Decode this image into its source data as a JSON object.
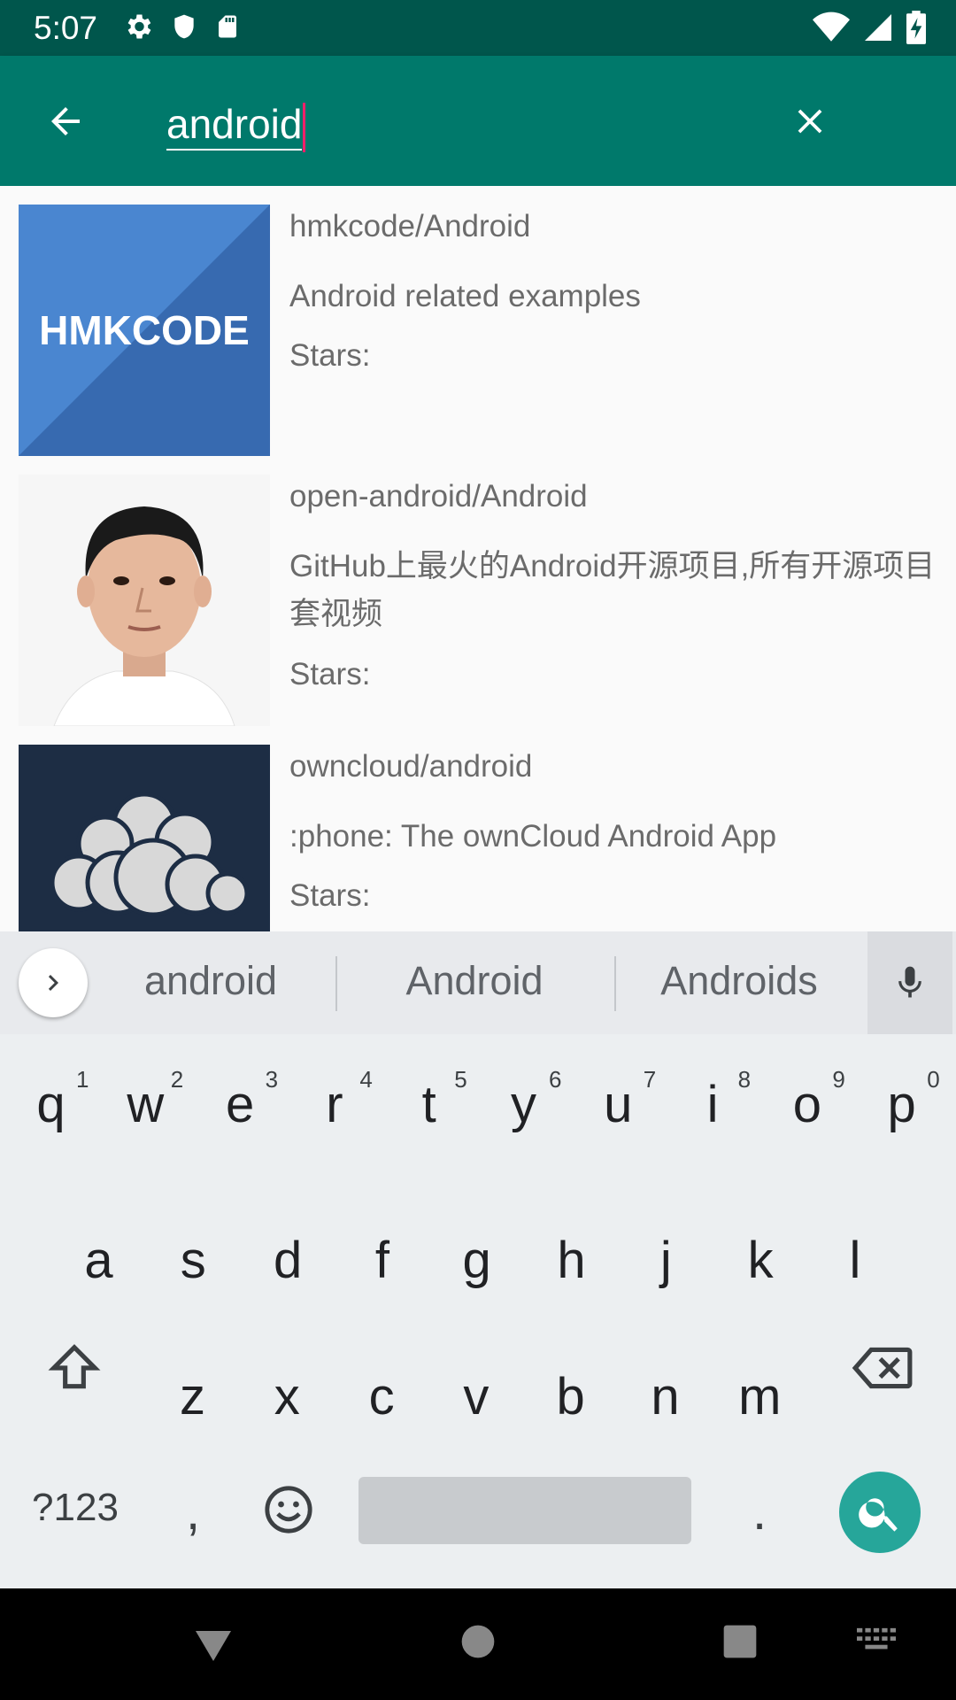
{
  "status_bar": {
    "time": "5:07"
  },
  "app_bar": {
    "search_value": "android"
  },
  "results": [
    {
      "title": "hmkcode/Android",
      "description": "Android related examples",
      "stars_label": "Stars:",
      "avatar_text": "HMKCODE"
    },
    {
      "title": "open-android/Android",
      "description": "GitHub上最火的Android开源项目,所有开源项目",
      "description_line2": "套视频",
      "stars_label": "Stars:"
    },
    {
      "title": "owncloud/android",
      "description": ":phone: The ownCloud Android App",
      "stars_label": "Stars:"
    }
  ],
  "keyboard": {
    "suggestions": [
      "android",
      "Android",
      "Androids"
    ],
    "row1": [
      "q",
      "w",
      "e",
      "r",
      "t",
      "y",
      "u",
      "i",
      "o",
      "p"
    ],
    "row1_hints": [
      "1",
      "2",
      "3",
      "4",
      "5",
      "6",
      "7",
      "8",
      "9",
      "0"
    ],
    "row2": [
      "a",
      "s",
      "d",
      "f",
      "g",
      "h",
      "j",
      "k",
      "l"
    ],
    "row3": [
      "z",
      "x",
      "c",
      "v",
      "b",
      "n",
      "m"
    ],
    "symbols_label": "?123",
    "comma": ",",
    "period": "."
  }
}
